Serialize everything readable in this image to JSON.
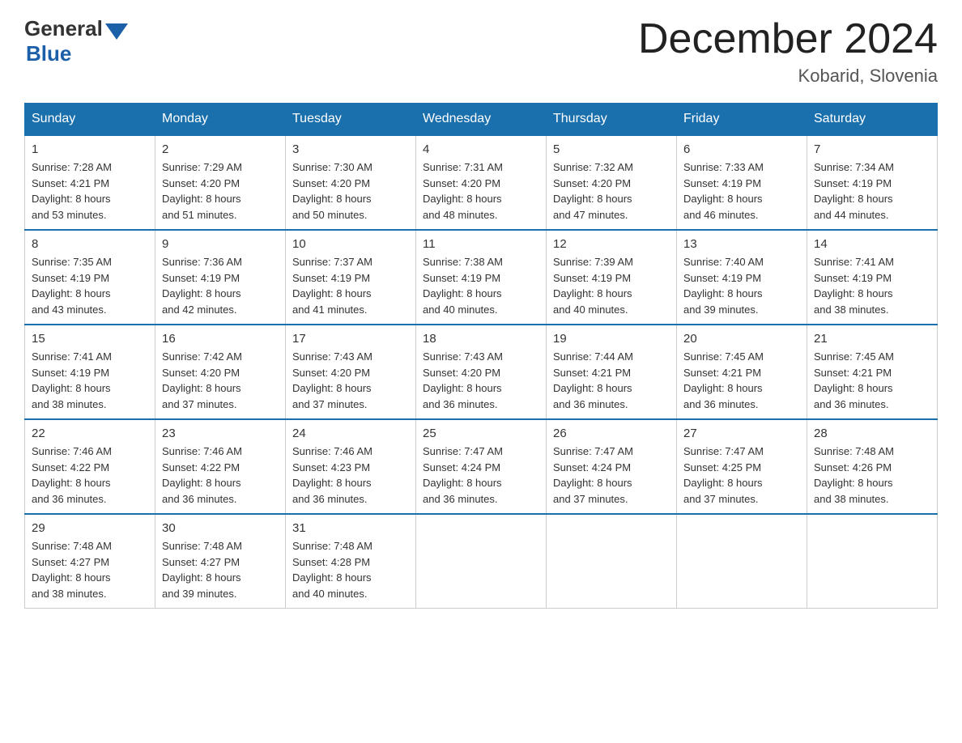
{
  "logo": {
    "general": "General",
    "blue": "Blue"
  },
  "title": {
    "month_year": "December 2024",
    "location": "Kobarid, Slovenia"
  },
  "days_of_week": [
    "Sunday",
    "Monday",
    "Tuesday",
    "Wednesday",
    "Thursday",
    "Friday",
    "Saturday"
  ],
  "weeks": [
    [
      {
        "day": "1",
        "sunrise": "7:28 AM",
        "sunset": "4:21 PM",
        "daylight": "8 hours and 53 minutes."
      },
      {
        "day": "2",
        "sunrise": "7:29 AM",
        "sunset": "4:20 PM",
        "daylight": "8 hours and 51 minutes."
      },
      {
        "day": "3",
        "sunrise": "7:30 AM",
        "sunset": "4:20 PM",
        "daylight": "8 hours and 50 minutes."
      },
      {
        "day": "4",
        "sunrise": "7:31 AM",
        "sunset": "4:20 PM",
        "daylight": "8 hours and 48 minutes."
      },
      {
        "day": "5",
        "sunrise": "7:32 AM",
        "sunset": "4:20 PM",
        "daylight": "8 hours and 47 minutes."
      },
      {
        "day": "6",
        "sunrise": "7:33 AM",
        "sunset": "4:19 PM",
        "daylight": "8 hours and 46 minutes."
      },
      {
        "day": "7",
        "sunrise": "7:34 AM",
        "sunset": "4:19 PM",
        "daylight": "8 hours and 44 minutes."
      }
    ],
    [
      {
        "day": "8",
        "sunrise": "7:35 AM",
        "sunset": "4:19 PM",
        "daylight": "8 hours and 43 minutes."
      },
      {
        "day": "9",
        "sunrise": "7:36 AM",
        "sunset": "4:19 PM",
        "daylight": "8 hours and 42 minutes."
      },
      {
        "day": "10",
        "sunrise": "7:37 AM",
        "sunset": "4:19 PM",
        "daylight": "8 hours and 41 minutes."
      },
      {
        "day": "11",
        "sunrise": "7:38 AM",
        "sunset": "4:19 PM",
        "daylight": "8 hours and 40 minutes."
      },
      {
        "day": "12",
        "sunrise": "7:39 AM",
        "sunset": "4:19 PM",
        "daylight": "8 hours and 40 minutes."
      },
      {
        "day": "13",
        "sunrise": "7:40 AM",
        "sunset": "4:19 PM",
        "daylight": "8 hours and 39 minutes."
      },
      {
        "day": "14",
        "sunrise": "7:41 AM",
        "sunset": "4:19 PM",
        "daylight": "8 hours and 38 minutes."
      }
    ],
    [
      {
        "day": "15",
        "sunrise": "7:41 AM",
        "sunset": "4:19 PM",
        "daylight": "8 hours and 38 minutes."
      },
      {
        "day": "16",
        "sunrise": "7:42 AM",
        "sunset": "4:20 PM",
        "daylight": "8 hours and 37 minutes."
      },
      {
        "day": "17",
        "sunrise": "7:43 AM",
        "sunset": "4:20 PM",
        "daylight": "8 hours and 37 minutes."
      },
      {
        "day": "18",
        "sunrise": "7:43 AM",
        "sunset": "4:20 PM",
        "daylight": "8 hours and 36 minutes."
      },
      {
        "day": "19",
        "sunrise": "7:44 AM",
        "sunset": "4:21 PM",
        "daylight": "8 hours and 36 minutes."
      },
      {
        "day": "20",
        "sunrise": "7:45 AM",
        "sunset": "4:21 PM",
        "daylight": "8 hours and 36 minutes."
      },
      {
        "day": "21",
        "sunrise": "7:45 AM",
        "sunset": "4:21 PM",
        "daylight": "8 hours and 36 minutes."
      }
    ],
    [
      {
        "day": "22",
        "sunrise": "7:46 AM",
        "sunset": "4:22 PM",
        "daylight": "8 hours and 36 minutes."
      },
      {
        "day": "23",
        "sunrise": "7:46 AM",
        "sunset": "4:22 PM",
        "daylight": "8 hours and 36 minutes."
      },
      {
        "day": "24",
        "sunrise": "7:46 AM",
        "sunset": "4:23 PM",
        "daylight": "8 hours and 36 minutes."
      },
      {
        "day": "25",
        "sunrise": "7:47 AM",
        "sunset": "4:24 PM",
        "daylight": "8 hours and 36 minutes."
      },
      {
        "day": "26",
        "sunrise": "7:47 AM",
        "sunset": "4:24 PM",
        "daylight": "8 hours and 37 minutes."
      },
      {
        "day": "27",
        "sunrise": "7:47 AM",
        "sunset": "4:25 PM",
        "daylight": "8 hours and 37 minutes."
      },
      {
        "day": "28",
        "sunrise": "7:48 AM",
        "sunset": "4:26 PM",
        "daylight": "8 hours and 38 minutes."
      }
    ],
    [
      {
        "day": "29",
        "sunrise": "7:48 AM",
        "sunset": "4:27 PM",
        "daylight": "8 hours and 38 minutes."
      },
      {
        "day": "30",
        "sunrise": "7:48 AM",
        "sunset": "4:27 PM",
        "daylight": "8 hours and 39 minutes."
      },
      {
        "day": "31",
        "sunrise": "7:48 AM",
        "sunset": "4:28 PM",
        "daylight": "8 hours and 40 minutes."
      },
      null,
      null,
      null,
      null
    ]
  ],
  "labels": {
    "sunrise": "Sunrise:",
    "sunset": "Sunset:",
    "daylight": "Daylight:"
  }
}
